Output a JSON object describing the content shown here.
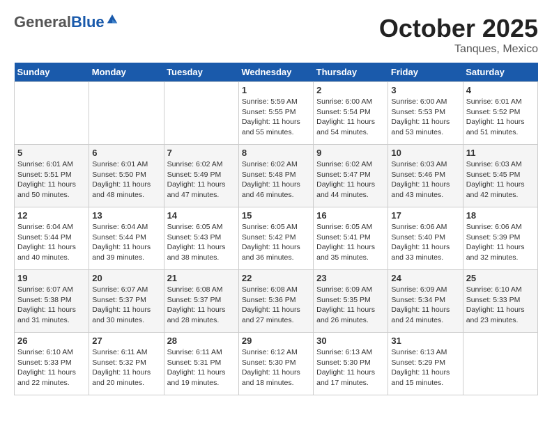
{
  "header": {
    "logo_general": "General",
    "logo_blue": "Blue",
    "month_title": "October 2025",
    "location": "Tanques, Mexico"
  },
  "weekdays": [
    "Sunday",
    "Monday",
    "Tuesday",
    "Wednesday",
    "Thursday",
    "Friday",
    "Saturday"
  ],
  "weeks": [
    [
      {
        "day": "",
        "sunrise": "",
        "sunset": "",
        "daylight": ""
      },
      {
        "day": "",
        "sunrise": "",
        "sunset": "",
        "daylight": ""
      },
      {
        "day": "",
        "sunrise": "",
        "sunset": "",
        "daylight": ""
      },
      {
        "day": "1",
        "sunrise": "Sunrise: 5:59 AM",
        "sunset": "Sunset: 5:55 PM",
        "daylight": "Daylight: 11 hours and 55 minutes."
      },
      {
        "day": "2",
        "sunrise": "Sunrise: 6:00 AM",
        "sunset": "Sunset: 5:54 PM",
        "daylight": "Daylight: 11 hours and 54 minutes."
      },
      {
        "day": "3",
        "sunrise": "Sunrise: 6:00 AM",
        "sunset": "Sunset: 5:53 PM",
        "daylight": "Daylight: 11 hours and 53 minutes."
      },
      {
        "day": "4",
        "sunrise": "Sunrise: 6:01 AM",
        "sunset": "Sunset: 5:52 PM",
        "daylight": "Daylight: 11 hours and 51 minutes."
      }
    ],
    [
      {
        "day": "5",
        "sunrise": "Sunrise: 6:01 AM",
        "sunset": "Sunset: 5:51 PM",
        "daylight": "Daylight: 11 hours and 50 minutes."
      },
      {
        "day": "6",
        "sunrise": "Sunrise: 6:01 AM",
        "sunset": "Sunset: 5:50 PM",
        "daylight": "Daylight: 11 hours and 48 minutes."
      },
      {
        "day": "7",
        "sunrise": "Sunrise: 6:02 AM",
        "sunset": "Sunset: 5:49 PM",
        "daylight": "Daylight: 11 hours and 47 minutes."
      },
      {
        "day": "8",
        "sunrise": "Sunrise: 6:02 AM",
        "sunset": "Sunset: 5:48 PM",
        "daylight": "Daylight: 11 hours and 46 minutes."
      },
      {
        "day": "9",
        "sunrise": "Sunrise: 6:02 AM",
        "sunset": "Sunset: 5:47 PM",
        "daylight": "Daylight: 11 hours and 44 minutes."
      },
      {
        "day": "10",
        "sunrise": "Sunrise: 6:03 AM",
        "sunset": "Sunset: 5:46 PM",
        "daylight": "Daylight: 11 hours and 43 minutes."
      },
      {
        "day": "11",
        "sunrise": "Sunrise: 6:03 AM",
        "sunset": "Sunset: 5:45 PM",
        "daylight": "Daylight: 11 hours and 42 minutes."
      }
    ],
    [
      {
        "day": "12",
        "sunrise": "Sunrise: 6:04 AM",
        "sunset": "Sunset: 5:44 PM",
        "daylight": "Daylight: 11 hours and 40 minutes."
      },
      {
        "day": "13",
        "sunrise": "Sunrise: 6:04 AM",
        "sunset": "Sunset: 5:44 PM",
        "daylight": "Daylight: 11 hours and 39 minutes."
      },
      {
        "day": "14",
        "sunrise": "Sunrise: 6:05 AM",
        "sunset": "Sunset: 5:43 PM",
        "daylight": "Daylight: 11 hours and 38 minutes."
      },
      {
        "day": "15",
        "sunrise": "Sunrise: 6:05 AM",
        "sunset": "Sunset: 5:42 PM",
        "daylight": "Daylight: 11 hours and 36 minutes."
      },
      {
        "day": "16",
        "sunrise": "Sunrise: 6:05 AM",
        "sunset": "Sunset: 5:41 PM",
        "daylight": "Daylight: 11 hours and 35 minutes."
      },
      {
        "day": "17",
        "sunrise": "Sunrise: 6:06 AM",
        "sunset": "Sunset: 5:40 PM",
        "daylight": "Daylight: 11 hours and 33 minutes."
      },
      {
        "day": "18",
        "sunrise": "Sunrise: 6:06 AM",
        "sunset": "Sunset: 5:39 PM",
        "daylight": "Daylight: 11 hours and 32 minutes."
      }
    ],
    [
      {
        "day": "19",
        "sunrise": "Sunrise: 6:07 AM",
        "sunset": "Sunset: 5:38 PM",
        "daylight": "Daylight: 11 hours and 31 minutes."
      },
      {
        "day": "20",
        "sunrise": "Sunrise: 6:07 AM",
        "sunset": "Sunset: 5:37 PM",
        "daylight": "Daylight: 11 hours and 30 minutes."
      },
      {
        "day": "21",
        "sunrise": "Sunrise: 6:08 AM",
        "sunset": "Sunset: 5:37 PM",
        "daylight": "Daylight: 11 hours and 28 minutes."
      },
      {
        "day": "22",
        "sunrise": "Sunrise: 6:08 AM",
        "sunset": "Sunset: 5:36 PM",
        "daylight": "Daylight: 11 hours and 27 minutes."
      },
      {
        "day": "23",
        "sunrise": "Sunrise: 6:09 AM",
        "sunset": "Sunset: 5:35 PM",
        "daylight": "Daylight: 11 hours and 26 minutes."
      },
      {
        "day": "24",
        "sunrise": "Sunrise: 6:09 AM",
        "sunset": "Sunset: 5:34 PM",
        "daylight": "Daylight: 11 hours and 24 minutes."
      },
      {
        "day": "25",
        "sunrise": "Sunrise: 6:10 AM",
        "sunset": "Sunset: 5:33 PM",
        "daylight": "Daylight: 11 hours and 23 minutes."
      }
    ],
    [
      {
        "day": "26",
        "sunrise": "Sunrise: 6:10 AM",
        "sunset": "Sunset: 5:33 PM",
        "daylight": "Daylight: 11 hours and 22 minutes."
      },
      {
        "day": "27",
        "sunrise": "Sunrise: 6:11 AM",
        "sunset": "Sunset: 5:32 PM",
        "daylight": "Daylight: 11 hours and 20 minutes."
      },
      {
        "day": "28",
        "sunrise": "Sunrise: 6:11 AM",
        "sunset": "Sunset: 5:31 PM",
        "daylight": "Daylight: 11 hours and 19 minutes."
      },
      {
        "day": "29",
        "sunrise": "Sunrise: 6:12 AM",
        "sunset": "Sunset: 5:30 PM",
        "daylight": "Daylight: 11 hours and 18 minutes."
      },
      {
        "day": "30",
        "sunrise": "Sunrise: 6:13 AM",
        "sunset": "Sunset: 5:30 PM",
        "daylight": "Daylight: 11 hours and 17 minutes."
      },
      {
        "day": "31",
        "sunrise": "Sunrise: 6:13 AM",
        "sunset": "Sunset: 5:29 PM",
        "daylight": "Daylight: 11 hours and 15 minutes."
      },
      {
        "day": "",
        "sunrise": "",
        "sunset": "",
        "daylight": ""
      }
    ]
  ]
}
